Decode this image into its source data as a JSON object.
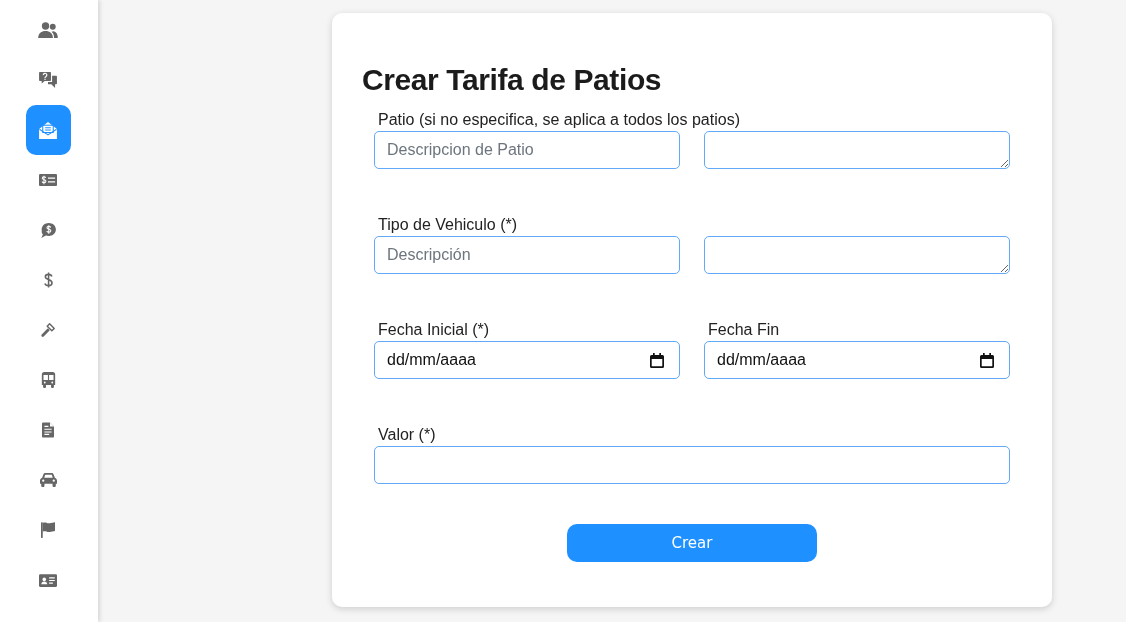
{
  "sidebar": {
    "items": [
      {
        "selected": false
      },
      {
        "selected": false
      },
      {
        "selected": true
      },
      {
        "selected": false
      },
      {
        "selected": false
      },
      {
        "selected": false
      },
      {
        "selected": false
      },
      {
        "selected": false
      },
      {
        "selected": false
      },
      {
        "selected": false
      },
      {
        "selected": false
      },
      {
        "selected": false
      }
    ]
  },
  "form": {
    "title": "Crear Tarifa de Patios",
    "rows": [
      {
        "fields": [
          {
            "kind": "text",
            "label": "Patio (si no especifica, se aplica a todos los patios)",
            "placeholder": "Descripcion de Patio"
          },
          {
            "kind": "textarea"
          }
        ]
      },
      {
        "fields": [
          {
            "kind": "text",
            "label": "Tipo de Vehiculo (*)",
            "placeholder": "Descripción"
          },
          {
            "kind": "textarea"
          }
        ]
      },
      {
        "fields": [
          {
            "kind": "date",
            "label": "Fecha Inicial (*)",
            "placeholder": "dd/mm/aaaa"
          },
          {
            "kind": "date",
            "label": "Fecha Fin",
            "placeholder": "dd/mm/aaaa"
          }
        ]
      },
      {
        "fields": [
          {
            "kind": "text",
            "label": "Valor (*)"
          }
        ]
      }
    ],
    "submit_button": "Crear"
  }
}
